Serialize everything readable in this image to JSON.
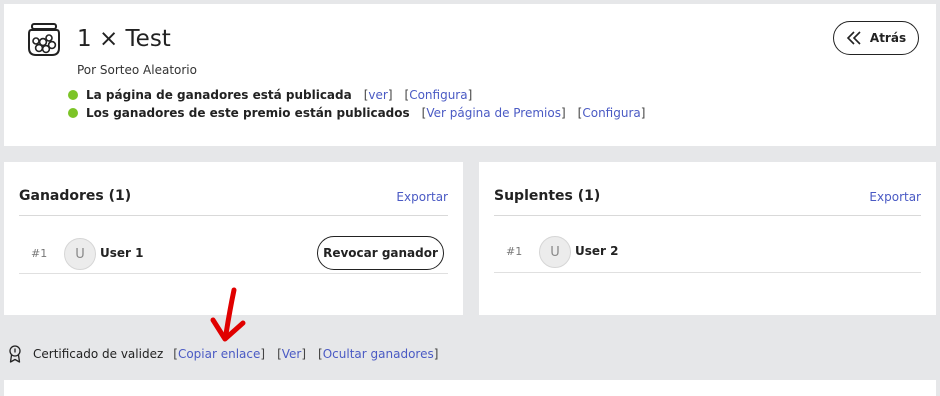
{
  "header": {
    "title": "1 × Test",
    "subtitle": "Por Sorteo Aleatorio",
    "back_label": "Atrás"
  },
  "status": [
    {
      "text": "La página de ganadores está publicada",
      "links": [
        "ver",
        "Configura"
      ]
    },
    {
      "text": "Los ganadores de este premio están publicados",
      "links": [
        "Ver página de Premios",
        "Configura"
      ]
    }
  ],
  "winners_panel": {
    "title": "Ganadores (1)",
    "export_label": "Exportar",
    "entries": [
      {
        "rank": "#1",
        "initial": "U",
        "name": "User 1",
        "action_label": "Revocar ganador"
      }
    ]
  },
  "substitutes_panel": {
    "title": "Suplentes (1)",
    "export_label": "Exportar",
    "entries": [
      {
        "rank": "#1",
        "initial": "U",
        "name": "User 2"
      }
    ]
  },
  "certificate": {
    "label": "Certificado de validez",
    "links": [
      "Copiar enlace",
      "Ver",
      "Ocultar ganadores"
    ]
  },
  "colors": {
    "status_dot": "#7cc427",
    "link": "#4a5ac4",
    "annotation_arrow": "#e00000"
  }
}
